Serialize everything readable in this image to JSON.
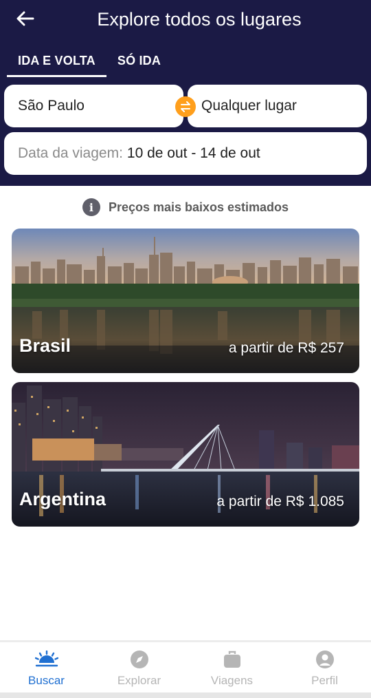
{
  "header": {
    "title": "Explore todos os lugares",
    "back_icon": "arrow-left-icon"
  },
  "tabs": [
    {
      "label": "IDA E VOLTA",
      "active": true
    },
    {
      "label": "SÓ IDA",
      "active": false
    }
  ],
  "search": {
    "origin": "São Paulo",
    "destination": "Qualquer lugar",
    "date_label": "Data da viagem:",
    "date_value": "10 de out - 14 de out",
    "swap_icon": "swap-arrows-icon"
  },
  "info": {
    "icon": "info-icon",
    "icon_glyph": "i",
    "text": "Preços mais baixos estimados"
  },
  "destinations": [
    {
      "name": "Brasil",
      "price": "a partir de R$ 257"
    },
    {
      "name": "Argentina",
      "price": "a partir de R$ 1.085"
    }
  ],
  "nav": {
    "items": [
      {
        "label": "Buscar",
        "icon": "sunrise-icon",
        "active": true
      },
      {
        "label": "Explorar",
        "icon": "compass-icon",
        "active": false
      },
      {
        "label": "Viagens",
        "icon": "suitcase-icon",
        "active": false
      },
      {
        "label": "Perfil",
        "icon": "user-icon",
        "active": false
      }
    ]
  },
  "colors": {
    "header_bg": "#1b1a45",
    "accent_orange": "#ff9f1c",
    "active_blue": "#1f6fd1",
    "inactive_gray": "#b5b5b5"
  }
}
